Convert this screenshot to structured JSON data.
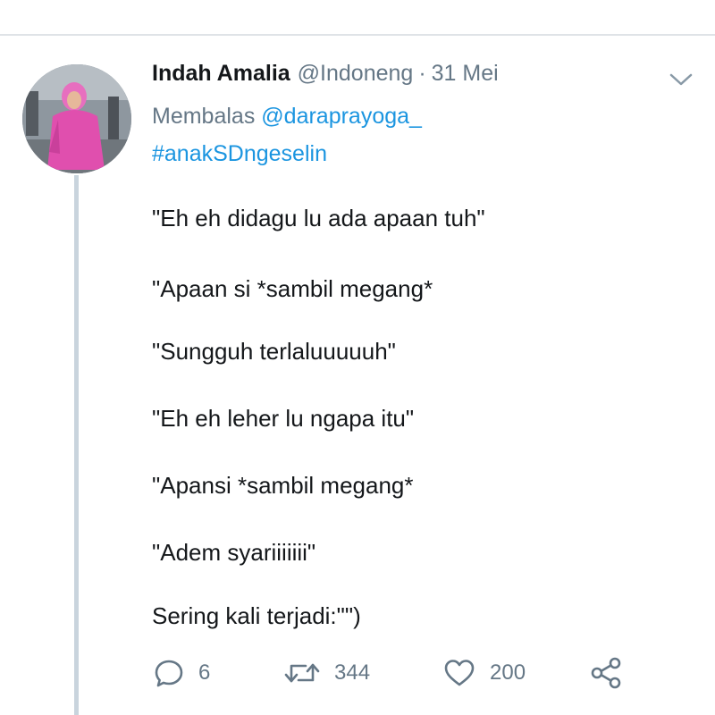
{
  "tweet": {
    "author_name": "Indah Amalia",
    "author_handle": "@Indoneng",
    "separator": "·",
    "date": "31 Mei",
    "reply_prefix": "Membalas",
    "reply_to": "@daraprayoga_",
    "hashtag": "#anakSDngeselin",
    "lines": [
      "\"Eh eh didagu lu ada apaan tuh\"",
      "\"Apaan si *sambil megang*",
      "\"Sungguh terlaluuuuuh\"",
      "\"Eh eh leher lu ngapa itu\"",
      "\"Apansi *sambil megang*",
      "\"Adem syariiiiiii\"",
      "Sering kali terjadi:\"\")"
    ]
  },
  "actions": {
    "reply_count": "6",
    "retweet_count": "344",
    "like_count": "200"
  },
  "colors": {
    "text": "#14171a",
    "muted": "#657786",
    "link": "#1b95e0",
    "thread_line": "#c9d4dd"
  },
  "icons": [
    "reply-icon",
    "retweet-icon",
    "like-icon",
    "share-icon",
    "chevron-down-icon"
  ]
}
